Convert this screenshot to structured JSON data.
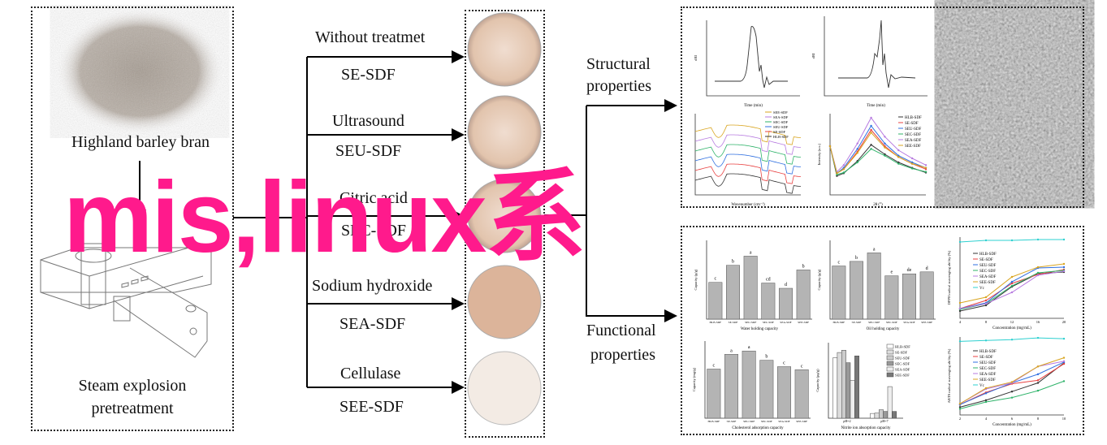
{
  "left": {
    "bran_label": "Highland barley bran",
    "steam_line1": "Steam explosion",
    "steam_line2": "pretreatment"
  },
  "treatments": [
    {
      "method": "Without treatmet",
      "sample": "SE-SDF"
    },
    {
      "method": "Ultrasound",
      "sample": "SEU-SDF"
    },
    {
      "method": "Citric acid",
      "sample": "SEC-SDF"
    },
    {
      "method": "Sodium hydroxide",
      "sample": "SEA-SDF"
    },
    {
      "method": "Cellulase",
      "sample": "SEE-SDF"
    }
  ],
  "properties": {
    "structural_1": "Structural",
    "structural_2": "properties",
    "functional_1": "Functional",
    "functional_2": "properties"
  },
  "watermark": "mis,linux系",
  "colors": {
    "watermark": "#ff1a8c",
    "bar": "#b4b4b4",
    "dish": "#e3c9b3"
  },
  "series_colors": {
    "HLB-SDF": "#333333",
    "SE-SDF": "#e84040",
    "SEU-SDF": "#2f6fe0",
    "SEC-SDF": "#2fb36a",
    "SEA-SDF": "#b77be0",
    "SEE-SDF": "#d9a520",
    "Vc": "#2ed0d0"
  },
  "chart_data": [
    {
      "id": "whc",
      "type": "bar",
      "xlabel": "Water holding capacity",
      "ylabel": "Capacity (g/g)",
      "ylim": [
        0,
        6
      ],
      "categories": [
        "HLB-SDF",
        "SE-SDF",
        "SEU-SDF",
        "SEC-SDF",
        "SEA-SDF",
        "SEE-SDF"
      ],
      "values": [
        2.8,
        4.1,
        4.8,
        2.75,
        2.35,
        3.75
      ],
      "letters": [
        "c",
        "b",
        "a",
        "cd",
        "d",
        "b"
      ]
    },
    {
      "id": "ohc",
      "type": "bar",
      "xlabel": "Oil holding capacity",
      "ylabel": "Capacity (g/g)",
      "ylim": [
        0,
        6
      ],
      "categories": [
        "HLB-SDF",
        "SE-SDF",
        "SEU-SDF",
        "SEC-SDF",
        "SEA-SDF",
        "SEE-SDF"
      ],
      "values": [
        4.05,
        4.4,
        5.05,
        3.3,
        3.45,
        3.6
      ],
      "letters": [
        "c",
        "b",
        "a",
        "e",
        "de",
        "d"
      ]
    },
    {
      "id": "chol",
      "type": "bar",
      "xlabel": "Cholesterol adsorption capacity",
      "ylabel": "Capacity (mg/g)",
      "ylim": [
        0,
        35
      ],
      "categories": [
        "HLB-SDF",
        "SE-SDF",
        "SEU-SDF",
        "SEC-SDF",
        "SEA-SDF",
        "SEE-SDF"
      ],
      "values": [
        22.3,
        29,
        30.5,
        26.3,
        23.4,
        22
      ],
      "letters": [
        "c",
        "a",
        "a",
        "b",
        "c",
        "c"
      ]
    },
    {
      "id": "nitrite",
      "type": "bar",
      "xlabel": "Nitrite ion absorption capacity",
      "ylabel": "Capacity (μg/g)",
      "categories": [
        "pH=2",
        "pH=7"
      ],
      "series": [
        {
          "name": "HLB-SDF",
          "values": [
            800,
            14
          ]
        },
        {
          "name": "SE-SDF",
          "values": [
            870,
            15
          ]
        },
        {
          "name": "SEU-SDF",
          "values": [
            900,
            25
          ]
        },
        {
          "name": "SEC-SDF",
          "values": [
            735,
            20
          ]
        },
        {
          "name": "SEA-SDF",
          "values": [
            500,
            93
          ]
        },
        {
          "name": "SEE-SDF",
          "values": [
            825,
            20
          ]
        }
      ]
    },
    {
      "id": "dpph",
      "type": "line",
      "xlabel": "Concentration (mg/mL)",
      "ylabel": "DPPH radical scavenging ability (%)",
      "x": [
        4,
        8,
        12,
        16,
        20
      ],
      "ylim": [
        0,
        100
      ],
      "series": [
        {
          "name": "HLB-SDF",
          "values": [
            9,
            16,
            39,
            55,
            57
          ]
        },
        {
          "name": "SE-SDF",
          "values": [
            12,
            22,
            43,
            54,
            60
          ]
        },
        {
          "name": "SEU-SDF",
          "values": [
            12,
            19,
            45,
            62,
            63
          ]
        },
        {
          "name": "SEC-SDF",
          "values": [
            11,
            18,
            40,
            56,
            59
          ]
        },
        {
          "name": "SEA-SDF",
          "values": [
            12,
            18,
            32,
            53,
            58
          ]
        },
        {
          "name": "SEE-SDF",
          "values": [
            19,
            26,
            51,
            63,
            67
          ]
        },
        {
          "name": "Vc",
          "values": [
            94,
            96,
            96,
            97,
            97
          ]
        }
      ]
    },
    {
      "id": "abts",
      "type": "line",
      "xlabel": "Concentration (mg/mL)",
      "ylabel": "ABTS radical scavenging ability (%)",
      "x": [
        2,
        4,
        6,
        8,
        10
      ],
      "ylim": [
        10,
        100
      ],
      "series": [
        {
          "name": "HLB-SDF",
          "values": [
            19,
            27,
            37,
            47,
            70
          ]
        },
        {
          "name": "SE-SDF",
          "values": [
            22,
            36,
            46,
            50,
            69
          ]
        },
        {
          "name": "SEU-SDF",
          "values": [
            22,
            35,
            47,
            57,
            71
          ]
        },
        {
          "name": "SEC-SDF",
          "values": [
            17,
            25,
            30,
            38,
            49
          ]
        },
        {
          "name": "SEA-SDF",
          "values": [
            23,
            40,
            47,
            66,
            72
          ]
        },
        {
          "name": "SEE-SDF",
          "values": [
            23,
            41,
            48,
            66,
            76
          ]
        },
        {
          "name": "Vc",
          "values": [
            95,
            96,
            97,
            99,
            98
          ]
        }
      ]
    },
    {
      "id": "xrd",
      "type": "line",
      "xlabel": "2θ (°)",
      "ylabel": "Intensity (a.u.)",
      "x": [
        5,
        7.5,
        10,
        15,
        20,
        25,
        30,
        35,
        40
      ],
      "ylim": [
        0,
        60000
      ],
      "series": [
        {
          "name": "HLB-SDF",
          "values": [
            36000,
            14000,
            16000,
            25000,
            37000,
            30000,
            24000,
            20000,
            16500
          ]
        },
        {
          "name": "SE-SDF",
          "values": [
            36000,
            16000,
            19000,
            32000,
            48000,
            36000,
            28000,
            23000,
            19000
          ]
        },
        {
          "name": "SEU-SDF",
          "values": [
            36000,
            16000,
            20000,
            34000,
            51000,
            38000,
            29000,
            24000,
            20000
          ]
        },
        {
          "name": "SEC-SDF",
          "values": [
            36000,
            15000,
            16500,
            24000,
            34000,
            29000,
            23000,
            19500,
            17000
          ]
        },
        {
          "name": "SEA-SDF",
          "values": [
            36000,
            17000,
            22000,
            38000,
            57000,
            43000,
            33000,
            27000,
            22000
          ]
        },
        {
          "name": "SEE-SDF",
          "values": [
            36000,
            16000,
            19000,
            31000,
            46000,
            35000,
            28000,
            23000,
            20000
          ]
        }
      ]
    },
    {
      "id": "ftir",
      "type": "line",
      "xlabel": "Wavenumber (cm⁻¹)",
      "ylabel": "",
      "legend": [
        "SEE-SDF",
        "SEA-SDF",
        "SEC-SDF",
        "SEU-SDF",
        "SE-SDF",
        "HLB-SDF"
      ]
    },
    {
      "id": "gpc1",
      "type": "line",
      "xlabel": "Time (min)",
      "ylabel": "dRI"
    },
    {
      "id": "gpc2",
      "type": "line",
      "xlabel": "Time (min)",
      "ylabel": "dRI"
    }
  ]
}
